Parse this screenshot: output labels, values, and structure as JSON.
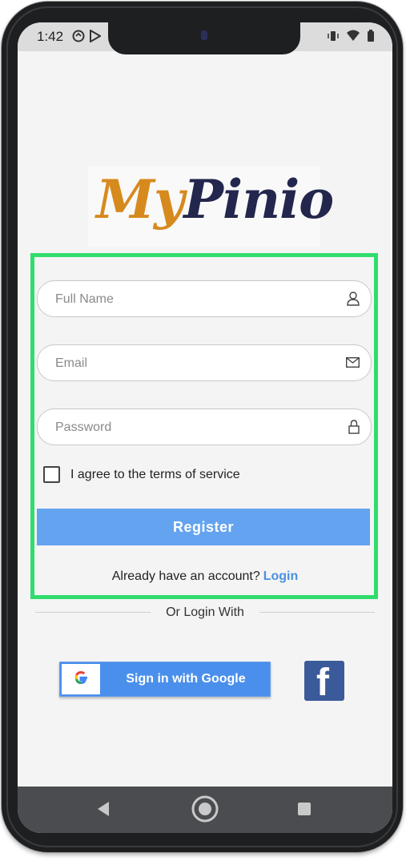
{
  "status_bar": {
    "time": "1:42"
  },
  "logo": {
    "part1": "My",
    "part2": "Pinio"
  },
  "form": {
    "full_name_placeholder": "Full Name",
    "email_placeholder": "Email",
    "password_placeholder": "Password",
    "agree_label": "I agree to the terms of service",
    "register_label": "Register",
    "already_text": "Already have an account?",
    "login_link": "Login"
  },
  "social": {
    "or_text": "Or Login With",
    "google_label": "Sign in with Google",
    "facebook_glyph": "f"
  },
  "colors": {
    "highlight": "#2fdc6d",
    "register_button": "#63a3ef",
    "google_button": "#4a8fec",
    "facebook": "#3b5a9a",
    "logo_my": "#d68a1e",
    "logo_pinio": "#23264d"
  }
}
